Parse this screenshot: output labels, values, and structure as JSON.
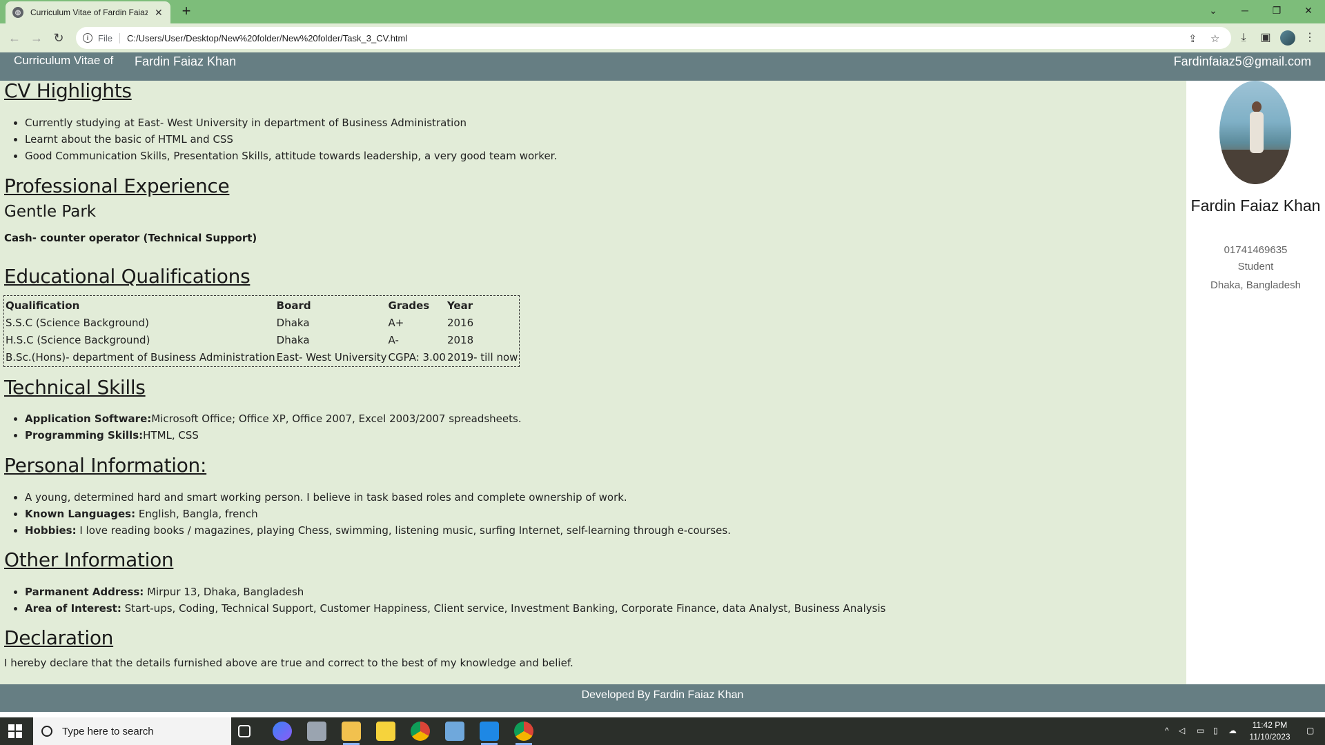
{
  "browser": {
    "tab_title": "Curriculum Vitae of Fardin Faiaz Khan",
    "tab_close": "✕",
    "new_tab": "+",
    "url_scheme": "File",
    "url": "C:/Users/User/Desktop/New%20folder/New%20folder/Task_3_CV.html"
  },
  "header": {
    "title": "Curriculum Vitae of",
    "name": "Fardin Faiaz Khan",
    "email": "Fardinfaiaz5@gmail.com"
  },
  "highlights": {
    "heading": "CV Highlights",
    "items": [
      "Currently studying at East- West University in department of Business Administration",
      "Learnt about the basic of HTML and CSS",
      "Good Communication Skills, Presentation Skills, attitude towards leadership, a very good team worker."
    ]
  },
  "experience": {
    "heading": "Professional Experience",
    "company": "Gentle Park",
    "role": "Cash- counter operator (Technical Support)"
  },
  "education": {
    "heading": "Educational Qualifications",
    "columns": [
      "Qualification",
      "Board",
      "Grades",
      "Year"
    ],
    "rows": [
      [
        "S.S.C (Science Background)",
        "Dhaka",
        "A+",
        "2016"
      ],
      [
        "H.S.C (Science Background)",
        "Dhaka",
        "A-",
        "2018"
      ],
      [
        "B.Sc.(Hons)- department of Business Administration",
        "East- West University",
        "CGPA: 3.00",
        "2019- till now"
      ]
    ]
  },
  "technical": {
    "heading": "Technical Skills",
    "items": [
      {
        "label": "Application Software:",
        "value": "Microsoft Office; Office XP, Office 2007, Excel 2003/2007 spreadsheets."
      },
      {
        "label": "Programming Skills:",
        "value": "HTML, CSS"
      }
    ]
  },
  "personal": {
    "heading": "Personal Information:",
    "intro": "A young, determined hard and smart working person. I believe in task based roles and complete ownership of work.",
    "items": [
      {
        "label": "Known Languages:",
        "value": " English, Bangla, french"
      },
      {
        "label": "Hobbies:",
        "value": " I love reading books / magazines, playing Chess, swimming, listening music, surfing Internet, self-learning through e-courses."
      }
    ]
  },
  "other": {
    "heading": "Other Information",
    "items": [
      {
        "label": "Parmanent Address:",
        "value": " Mirpur 13, Dhaka, Bangladesh"
      },
      {
        "label": "Area of Interest:",
        "value": " Start-ups, Coding, Technical Support, Customer Happiness, Client service, Investment Banking, Corporate Finance, data Analyst, Business Analysis"
      }
    ]
  },
  "declaration": {
    "heading": "Declaration",
    "text": "I hereby declare that the details furnished above are true and correct to the best of my knowledge and belief."
  },
  "sidebar": {
    "name": "Fardin Faiaz Khan",
    "phone": "01741469635",
    "status": "Student",
    "location": "Dhaka, Bangladesh"
  },
  "footer": {
    "text": "Developed By Fardin Faiaz Khan"
  },
  "taskbar": {
    "search_placeholder": "Type here to search",
    "time": "11:42 PM",
    "date": "11/10/2023"
  },
  "colors": {
    "tab_strip": "#7dbd7a",
    "toolbar": "#e1ecd6",
    "header_bar": "#667e83",
    "content_bg": "#e2ecd8"
  }
}
